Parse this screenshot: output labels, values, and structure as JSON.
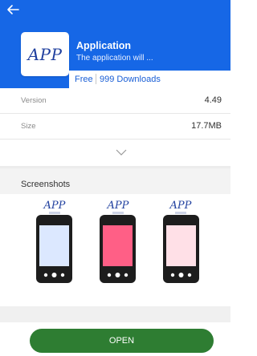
{
  "header": {
    "back_icon": "arrow-left-icon",
    "app_logo_text": "APP",
    "title": "Application",
    "subtitle": "The application will ...",
    "price": "Free",
    "downloads": "999 Downloads",
    "background_color": "#1667e6"
  },
  "details": [
    {
      "label": "Version",
      "value": "4.49"
    },
    {
      "label": "Size",
      "value": "17.7MB"
    }
  ],
  "expand_icon": "chevron-down-icon",
  "screenshots": {
    "title": "Screenshots",
    "items": [
      {
        "logo_text": "APP",
        "screen_color": "#dce8ff"
      },
      {
        "logo_text": "APP",
        "screen_color": "#ff5f86"
      },
      {
        "logo_text": "APP",
        "screen_color": "#ffe0e7"
      }
    ]
  },
  "footer": {
    "open_label": "OPEN",
    "button_color": "#2e7d32"
  }
}
